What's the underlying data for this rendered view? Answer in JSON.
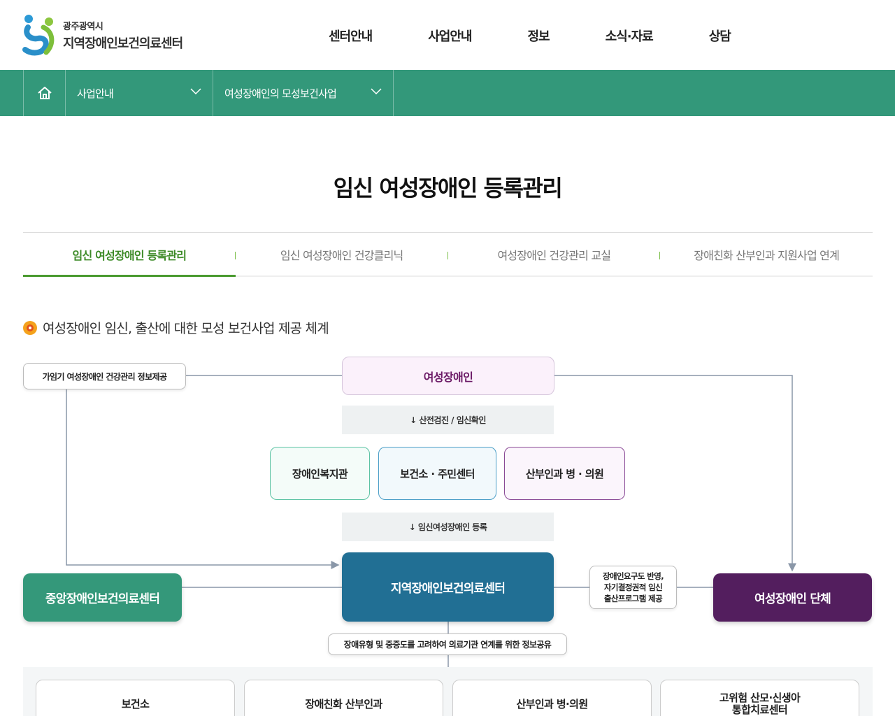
{
  "header": {
    "logo_sub": "광주광역시",
    "logo_main": "지역장애인보건의료센터",
    "nav": [
      "센터안내",
      "사업안내",
      "정보",
      "소식·자료",
      "상담"
    ]
  },
  "breadcrumb": {
    "home_icon": "home-icon",
    "level1": "사업안내",
    "level2": "여성장애인의 모성보건사업"
  },
  "page_title": "임신 여성장애인 등록관리",
  "tabs": [
    {
      "label": "임신 여성장애인 등록관리",
      "active": true
    },
    {
      "label": "임신 여성장애인 건강클리닉",
      "active": false
    },
    {
      "label": "여성장애인 건강관리 교실",
      "active": false
    },
    {
      "label": "장애친화 산부인과 지원사업 연계",
      "active": false
    }
  ],
  "section": {
    "title": "여성장애인 임신, 출산에 대한 모성 보건사업 제공 체계"
  },
  "diagram": {
    "info_label": "가임기 여성장애인 건강관리 정보제공",
    "women": "여성장애인",
    "step1": "↓ 산전검진 / 임신확인",
    "welfare": "장애인복지관",
    "health_center": "보건소 · 주민센터",
    "ob_clinic": "산부인과 병 · 의원",
    "step2": "↓ 임신여성장애인 등록",
    "central": "중앙장애인보건의료센터",
    "regional": "지역장애인보건의료센터",
    "program_label": [
      "장애인요구도 반영,",
      "자기결정권적 임신",
      "출산프로그램 제공"
    ],
    "women_org": "여성장애인 단체",
    "share_label": "장애유형 및 중증도를 고려하여 의료기관 연계를 위한 정보공유",
    "bottom": [
      "보건소",
      "장애친화 산부인과",
      "산부인과 병·의원",
      [
        "고위험 산모·신생아",
        "통합치료센터"
      ]
    ]
  },
  "colors": {
    "brand_green": "#33987a",
    "tab_active": "#3c8a26",
    "central_box": "#34987a",
    "regional_box": "#216f94",
    "org_box": "#531e5e",
    "women_text": "#6b1a66"
  }
}
